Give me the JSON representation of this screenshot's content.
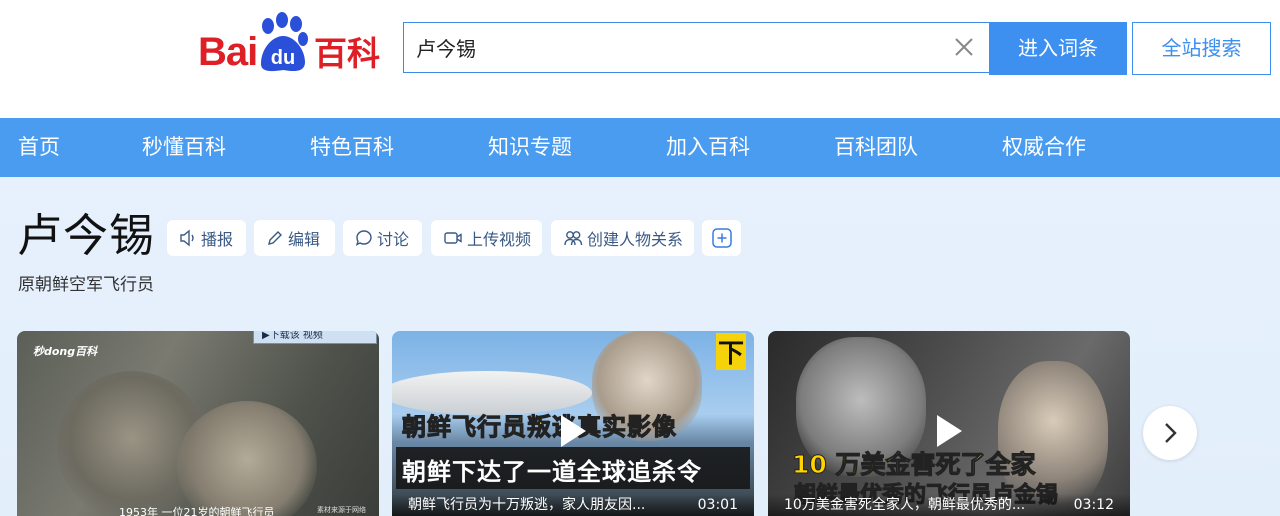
{
  "logo": {
    "bai": "Bai",
    "du": "du",
    "baike": "百科"
  },
  "search": {
    "value": "卢今锡",
    "enter_label": "进入词条",
    "all_label": "全站搜索"
  },
  "nav": [
    "首页",
    "秒懂百科",
    "特色百科",
    "知识专题",
    "加入百科",
    "百科团队",
    "权威合作"
  ],
  "entry": {
    "title": "卢今锡",
    "subtitle": "原朝鲜空军飞行员"
  },
  "tools": [
    {
      "label": "播报",
      "icon": "speaker-icon"
    },
    {
      "label": "编辑",
      "icon": "pencil-icon"
    },
    {
      "label": "讨论",
      "icon": "chat-bubble-icon"
    },
    {
      "label": "上传视频",
      "icon": "video-camera-icon"
    },
    {
      "label": "创建人物关系",
      "icon": "people-relation-icon"
    }
  ],
  "videos": [
    {
      "watermark": "秒dong百科",
      "topbar": "▶下载该 视频",
      "caption": "1953年 一位21岁的朝鲜飞行员",
      "source": "素材来源于网络",
      "title": "",
      "duration": ""
    },
    {
      "overlay_top": "下",
      "overlay_mid": "朝鲜飞行员叛逃真实影像",
      "overlay_bottom": "朝鲜下达了一道全球追杀令",
      "title": "朝鲜飞行员为十万叛逃，家人朋友因...",
      "duration": "03:01"
    },
    {
      "overlay_mid": "10 万美金害死了全家",
      "overlay_bottom": "朝鲜最优秀的飞行员卢金锡",
      "title": "10万美金害死全家人，朝鲜最优秀的...",
      "duration": "03:12"
    }
  ],
  "colors": {
    "brand_red": "#de1f26",
    "brand_blue": "#3d8ff0",
    "nav_bg": "#4a9cf0"
  }
}
